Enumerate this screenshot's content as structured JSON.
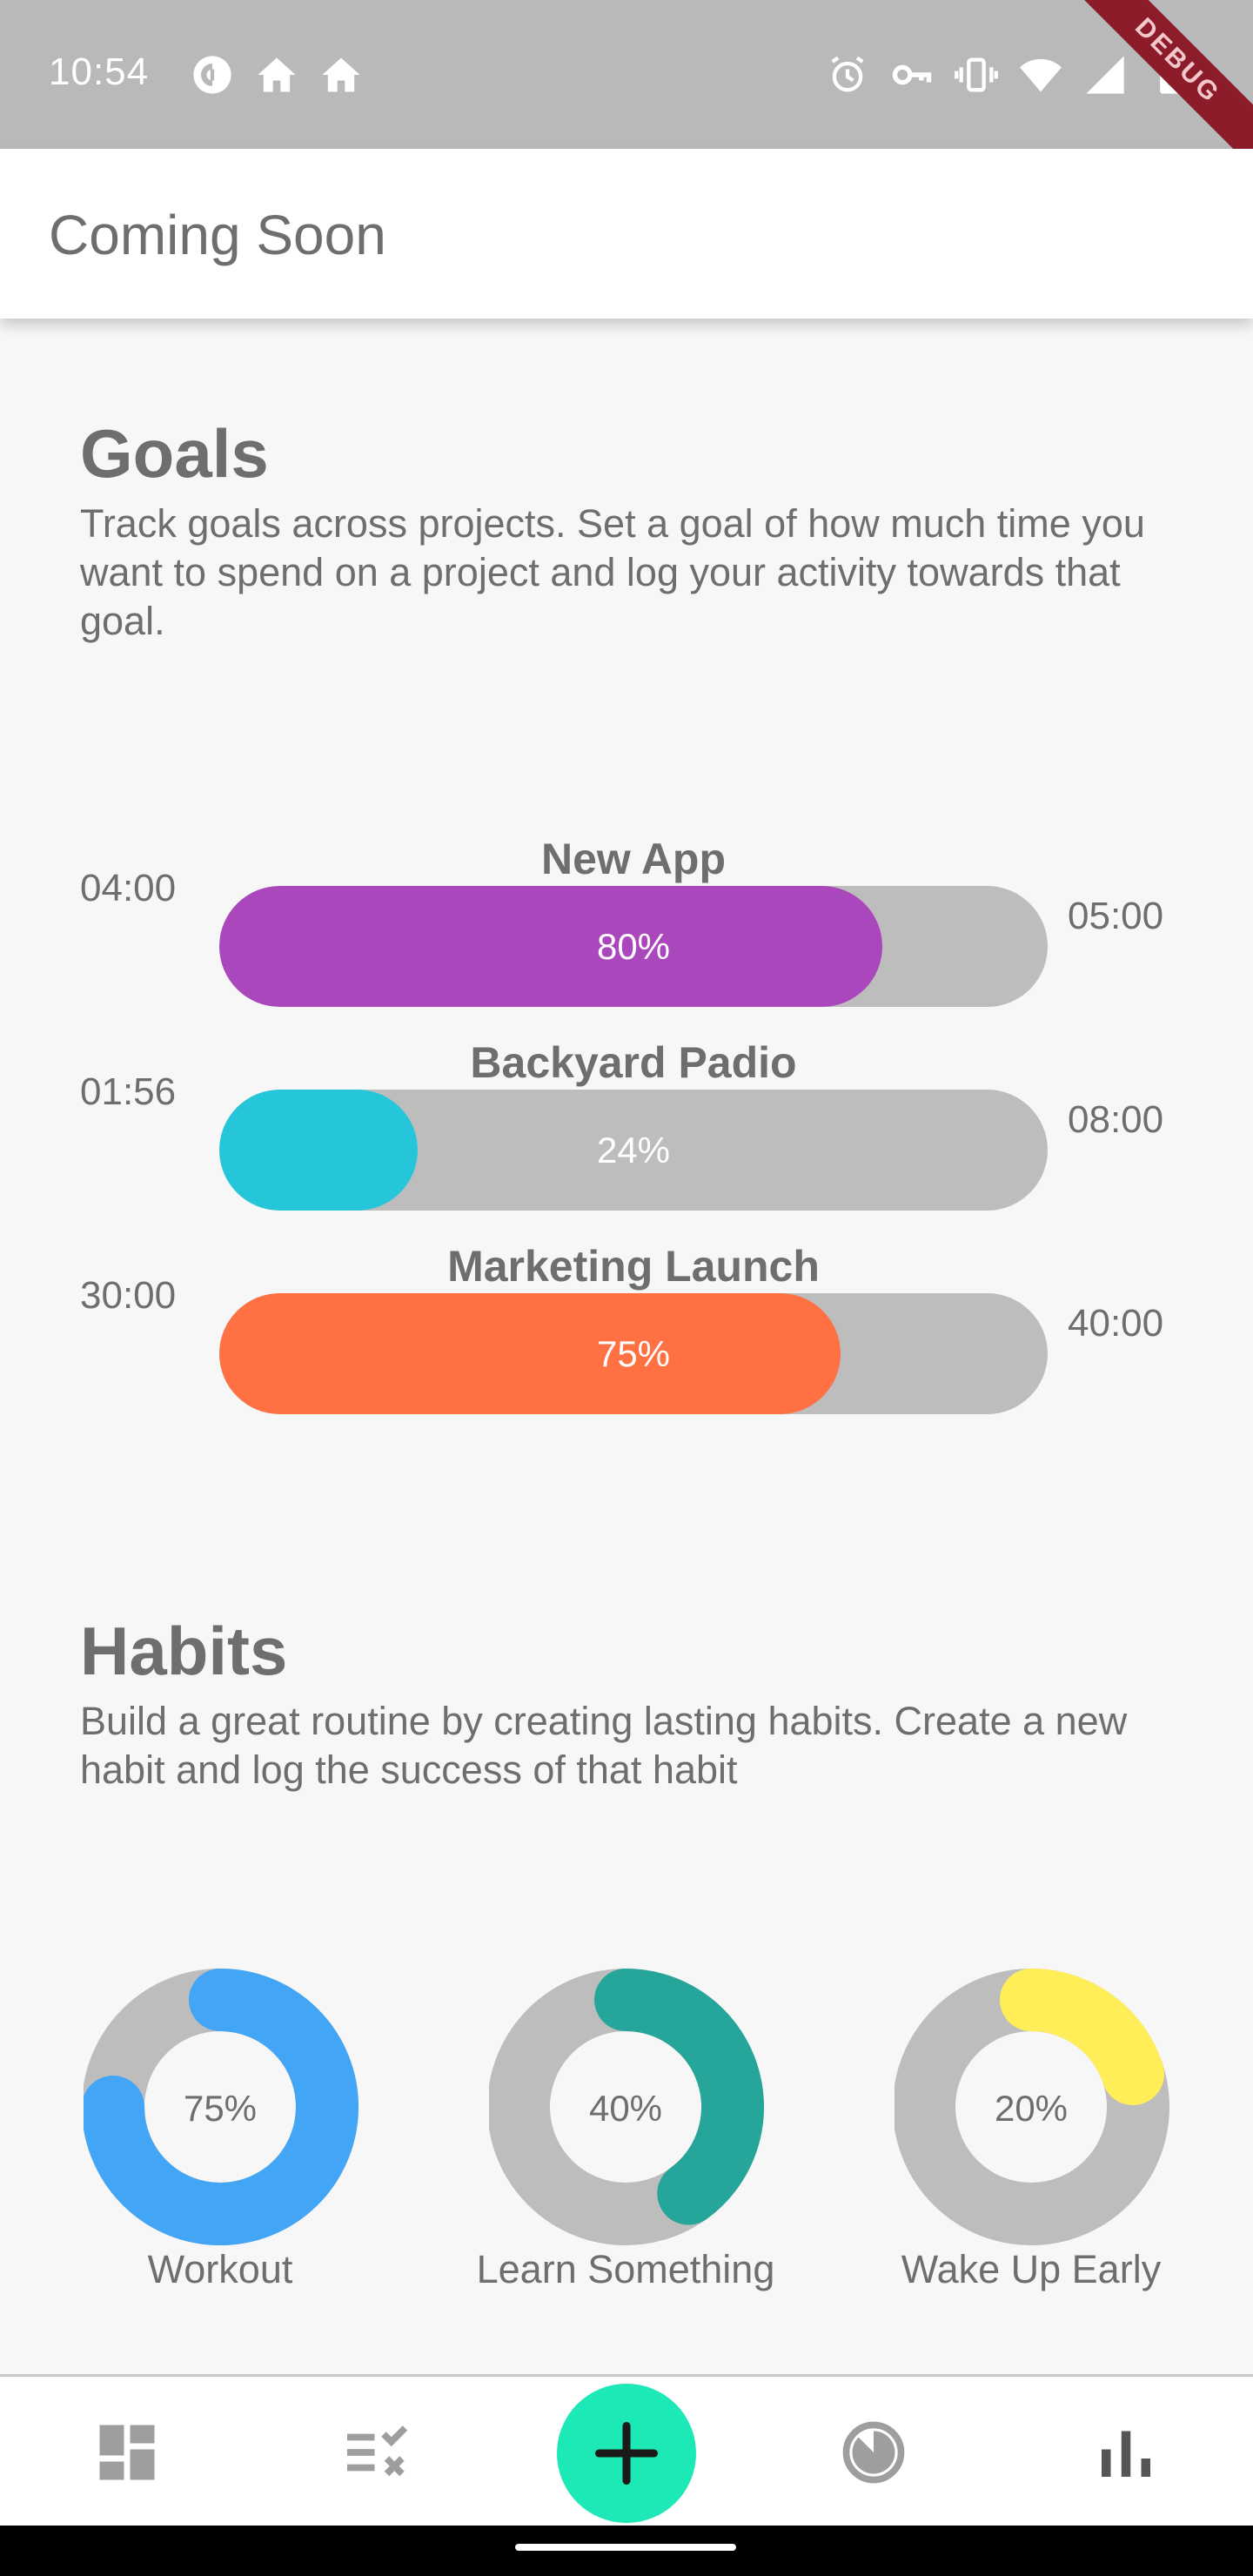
{
  "status_bar": {
    "time": "10:54",
    "debug_banner": "DEBUG",
    "left_icons": [
      "pocket-casts-icon",
      "home-icon",
      "home-icon"
    ],
    "right_icons": [
      "alarm-icon",
      "vpn-key-icon",
      "vibrate-icon",
      "wifi-icon",
      "cell-signal-icon",
      "battery-charging-icon"
    ]
  },
  "app_bar": {
    "title": "Coming Soon"
  },
  "goals": {
    "title": "Goals",
    "description": "Track goals across projects. Set a goal of how much time you want to spend on a project and log your activity towards that goal.",
    "items": [
      {
        "name": "New App",
        "logged": "04:00",
        "target": "05:00",
        "percent_label": "80%",
        "progress": 0.8,
        "color": "#ab47bc"
      },
      {
        "name": "Backyard Padio",
        "logged": "01:56",
        "target": "08:00",
        "percent_label": "24%",
        "progress": 0.24,
        "color": "#26c6da"
      },
      {
        "name": "Marketing Launch",
        "logged": "30:00",
        "target": "40:00",
        "percent_label": "75%",
        "progress": 0.75,
        "color": "#ff7043"
      }
    ]
  },
  "habits": {
    "title": "Habits",
    "description": "Build a great routine by creating lasting habits. Create a new habit and log the success of that habit",
    "items": [
      {
        "name": "Workout",
        "percent_label": "75%",
        "progress": 0.75,
        "color": "#42a5f5"
      },
      {
        "name": "Learn Something",
        "percent_label": "40%",
        "progress": 0.4,
        "color": "#26a69a"
      },
      {
        "name": "Wake Up Early",
        "percent_label": "20%",
        "progress": 0.2,
        "color": "#ffee58"
      }
    ]
  },
  "bottom_nav": {
    "items": [
      "dashboard-icon",
      "checklist-icon",
      "add-icon",
      "timer-icon",
      "bar-chart-icon"
    ],
    "fab_color": "#1de9b6"
  },
  "colors": {
    "track": "#bdbdbd",
    "text": "#6e6e6e",
    "status_bar": "#b9b9b9"
  }
}
